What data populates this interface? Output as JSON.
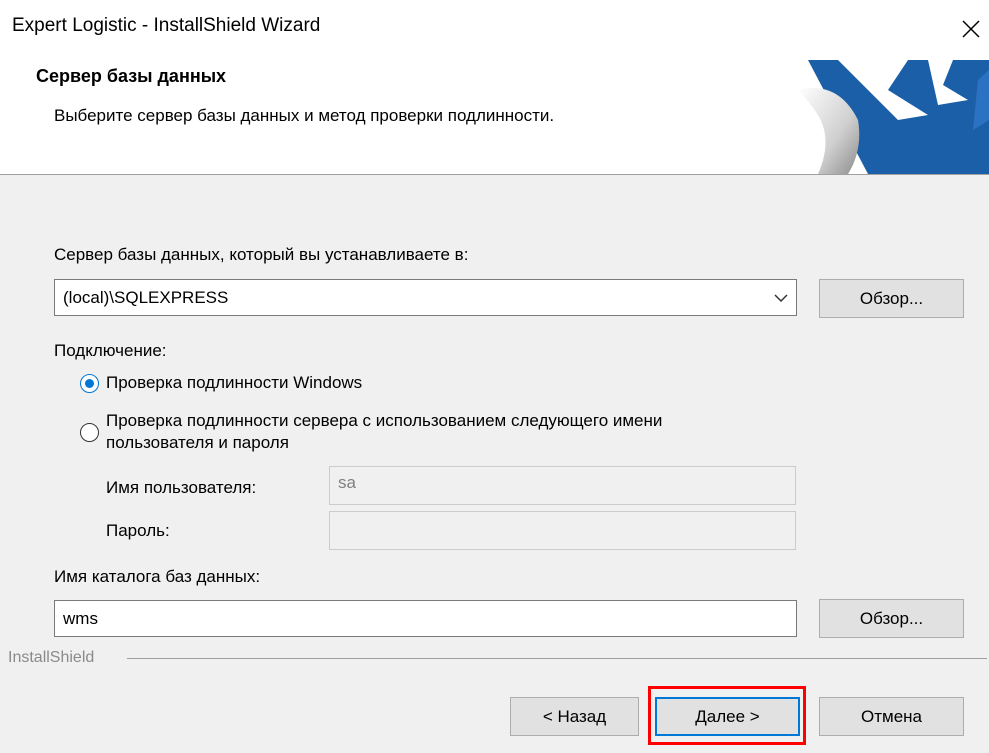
{
  "window": {
    "title": "Expert Logistic - InstallShield Wizard",
    "close_icon": "close-icon"
  },
  "header": {
    "title": "Сервер базы данных",
    "subtitle": "Выберите сервер базы данных и метод проверки подлинности.",
    "logo_icon": "installshield-logo-icon"
  },
  "server": {
    "label": "Сервер базы данных, который вы устанавливаете в:",
    "value": "(local)\\SQLEXPRESS",
    "browse_label": "Обзор..."
  },
  "connection": {
    "label": "Подключение:",
    "options": [
      {
        "label": "Проверка подлинности Windows",
        "selected": true
      },
      {
        "label_line1": "Проверка подлинности сервера с использованием следующего имени",
        "label_line2": "пользователя и пароля",
        "selected": false
      }
    ],
    "username_label": "Имя пользователя:",
    "username_value": "sa",
    "password_label": "Пароль:",
    "password_value": ""
  },
  "catalog": {
    "label": "Имя каталога баз данных:",
    "value": "wms",
    "browse_label": "Обзор..."
  },
  "footer": {
    "brand": "InstallShield",
    "back_label": "< Назад",
    "next_label": "Далее >",
    "cancel_label": "Отмена"
  },
  "colors": {
    "accent": "#0078d7",
    "highlight": "#ff0000"
  }
}
